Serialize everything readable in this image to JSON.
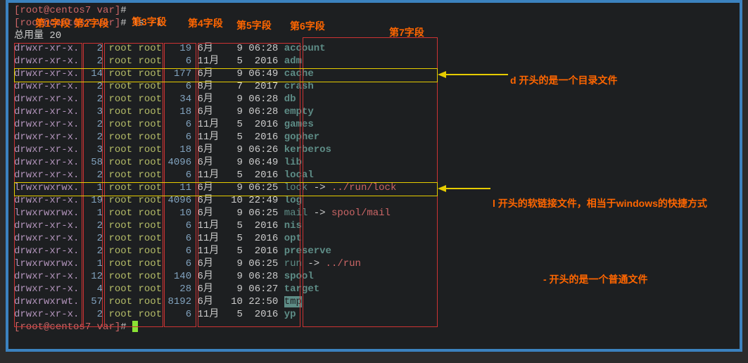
{
  "prompt": {
    "user": "root",
    "host": "centos7",
    "cwd": "var",
    "symbol": "#"
  },
  "command": "ls -l",
  "total_line": "总用量 20",
  "labels": {
    "f1": "第1字段",
    "f2": "第2字段",
    "f3": "第3字段",
    "f4": "第4字段",
    "f5": "第5字段",
    "f6": "第6字段",
    "f7": "第7字段",
    "note_d": "d 开头的是一个目录文件",
    "note_l": "l 开头的软链接文件，相当于windows的快捷方式",
    "note_dash": "- 开头的是一个普通文件"
  },
  "rows": [
    {
      "perm": "drwxr-xr-x.",
      "links": "2",
      "owner": "root",
      "group": "root",
      "size": "19",
      "month": "6月",
      "day": "9",
      "time": "06:28",
      "name": "account",
      "type": "dir"
    },
    {
      "perm": "drwxr-xr-x.",
      "links": "2",
      "owner": "root",
      "group": "root",
      "size": "6",
      "month": "11月",
      "day": "5",
      "time": "2016",
      "name": "adm",
      "type": "dir"
    },
    {
      "perm": "drwxr-xr-x.",
      "links": "14",
      "owner": "root",
      "group": "root",
      "size": "177",
      "month": "6月",
      "day": "9",
      "time": "06:49",
      "name": "cache",
      "type": "dir"
    },
    {
      "perm": "drwxr-xr-x.",
      "links": "2",
      "owner": "root",
      "group": "root",
      "size": "6",
      "month": "8月",
      "day": "7",
      "time": "2017",
      "name": "crash",
      "type": "dir"
    },
    {
      "perm": "drwxr-xr-x.",
      "links": "2",
      "owner": "root",
      "group": "root",
      "size": "34",
      "month": "6月",
      "day": "9",
      "time": "06:28",
      "name": "db",
      "type": "dir"
    },
    {
      "perm": "drwxr-xr-x.",
      "links": "3",
      "owner": "root",
      "group": "root",
      "size": "18",
      "month": "6月",
      "day": "9",
      "time": "06:28",
      "name": "empty",
      "type": "dir"
    },
    {
      "perm": "drwxr-xr-x.",
      "links": "2",
      "owner": "root",
      "group": "root",
      "size": "6",
      "month": "11月",
      "day": "5",
      "time": "2016",
      "name": "games",
      "type": "dir"
    },
    {
      "perm": "drwxr-xr-x.",
      "links": "2",
      "owner": "root",
      "group": "root",
      "size": "6",
      "month": "11月",
      "day": "5",
      "time": "2016",
      "name": "gopher",
      "type": "dir"
    },
    {
      "perm": "drwxr-xr-x.",
      "links": "3",
      "owner": "root",
      "group": "root",
      "size": "18",
      "month": "6月",
      "day": "9",
      "time": "06:26",
      "name": "kerberos",
      "type": "dir"
    },
    {
      "perm": "drwxr-xr-x.",
      "links": "58",
      "owner": "root",
      "group": "root",
      "size": "4096",
      "month": "6月",
      "day": "9",
      "time": "06:49",
      "name": "lib",
      "type": "dir"
    },
    {
      "perm": "drwxr-xr-x.",
      "links": "2",
      "owner": "root",
      "group": "root",
      "size": "6",
      "month": "11月",
      "day": "5",
      "time": "2016",
      "name": "local",
      "type": "dir"
    },
    {
      "perm": "lrwxrwxrwx.",
      "links": "1",
      "owner": "root",
      "group": "root",
      "size": "11",
      "month": "6月",
      "day": "9",
      "time": "06:25",
      "name": "lock",
      "type": "link",
      "target": "../run/lock"
    },
    {
      "perm": "drwxr-xr-x.",
      "links": "19",
      "owner": "root",
      "group": "root",
      "size": "4096",
      "month": "6月",
      "day": "10",
      "time": "22:49",
      "name": "log",
      "type": "dir"
    },
    {
      "perm": "lrwxrwxrwx.",
      "links": "1",
      "owner": "root",
      "group": "root",
      "size": "10",
      "month": "6月",
      "day": "9",
      "time": "06:25",
      "name": "mail",
      "type": "link",
      "target": "spool/mail"
    },
    {
      "perm": "drwxr-xr-x.",
      "links": "2",
      "owner": "root",
      "group": "root",
      "size": "6",
      "month": "11月",
      "day": "5",
      "time": "2016",
      "name": "nis",
      "type": "dir"
    },
    {
      "perm": "drwxr-xr-x.",
      "links": "2",
      "owner": "root",
      "group": "root",
      "size": "6",
      "month": "11月",
      "day": "5",
      "time": "2016",
      "name": "opt",
      "type": "dir"
    },
    {
      "perm": "drwxr-xr-x.",
      "links": "2",
      "owner": "root",
      "group": "root",
      "size": "6",
      "month": "11月",
      "day": "5",
      "time": "2016",
      "name": "preserve",
      "type": "dir"
    },
    {
      "perm": "lrwxrwxrwx.",
      "links": "1",
      "owner": "root",
      "group": "root",
      "size": "6",
      "month": "6月",
      "day": "9",
      "time": "06:25",
      "name": "run",
      "type": "link",
      "target": "../run"
    },
    {
      "perm": "drwxr-xr-x.",
      "links": "12",
      "owner": "root",
      "group": "root",
      "size": "140",
      "month": "6月",
      "day": "9",
      "time": "06:28",
      "name": "spool",
      "type": "dir"
    },
    {
      "perm": "drwxr-xr-x.",
      "links": "4",
      "owner": "root",
      "group": "root",
      "size": "28",
      "month": "6月",
      "day": "9",
      "time": "06:27",
      "name": "target",
      "type": "dir"
    },
    {
      "perm": "drwxrwxrwt.",
      "links": "57",
      "owner": "root",
      "group": "root",
      "size": "8192",
      "month": "6月",
      "day": "10",
      "time": "22:50",
      "name": "tmp",
      "type": "tmp"
    },
    {
      "perm": "drwxr-xr-x.",
      "links": "2",
      "owner": "root",
      "group": "root",
      "size": "6",
      "month": "11月",
      "day": "5",
      "time": "2016",
      "name": "yp",
      "type": "dir"
    }
  ]
}
